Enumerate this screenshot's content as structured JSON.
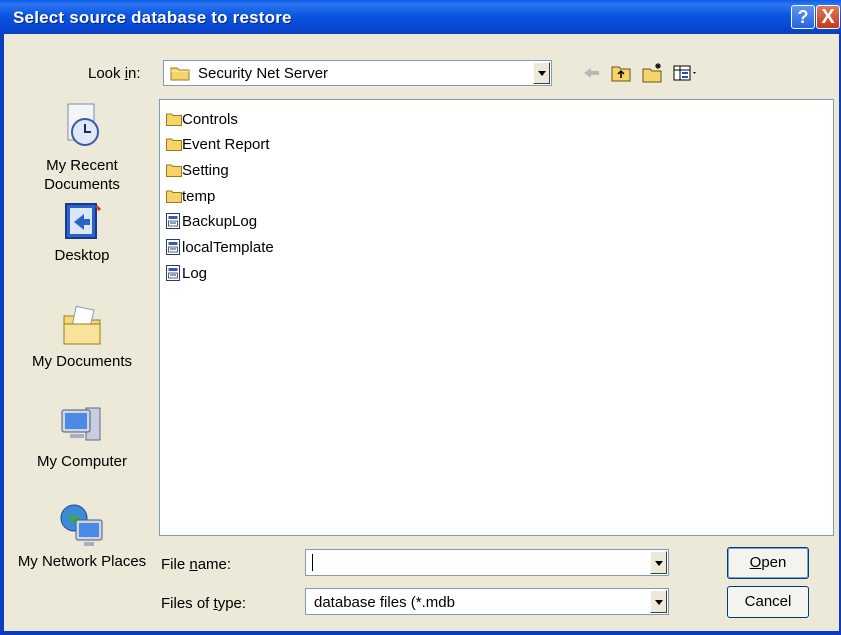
{
  "window": {
    "title": "Select source database to restore",
    "help_label": "?",
    "close_label": "X"
  },
  "lookin": {
    "label": "Look in:",
    "value": "Security Net  Server"
  },
  "places": [
    {
      "label": "My Recent Documents",
      "icon": "recent-documents-icon"
    },
    {
      "label": "Desktop",
      "icon": "desktop-icon"
    },
    {
      "label": "My Documents",
      "icon": "my-documents-icon"
    },
    {
      "label": "My Computer",
      "icon": "my-computer-icon"
    },
    {
      "label": "My Network Places",
      "icon": "network-places-icon"
    }
  ],
  "files": [
    {
      "name": "Controls",
      "type": "folder"
    },
    {
      "name": "Event Report",
      "type": "folder"
    },
    {
      "name": "Setting",
      "type": "folder"
    },
    {
      "name": "temp",
      "type": "folder"
    },
    {
      "name": "BackupLog",
      "type": "mdb"
    },
    {
      "name": "localTemplate",
      "type": "mdb"
    },
    {
      "name": "Log",
      "type": "mdb"
    }
  ],
  "filename": {
    "label": "File name:",
    "value": ""
  },
  "filetype": {
    "label": "Files of type:",
    "value": "database files (*.mdb"
  },
  "buttons": {
    "open": "Open",
    "cancel": "Cancel"
  },
  "colors": {
    "titlebar": "#0a56e0",
    "client": "#ece9d8",
    "folder": "#f5d56a"
  }
}
